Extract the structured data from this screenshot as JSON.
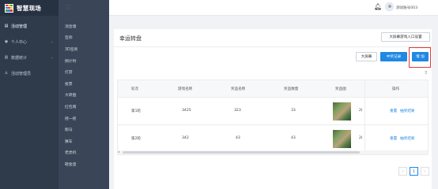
{
  "app": {
    "title": "智慧现场"
  },
  "sidebar": {
    "items": [
      {
        "label": "活动管理",
        "icon": "document-icon"
      },
      {
        "label": "个人中心",
        "icon": "user-icon"
      },
      {
        "label": "数据统计",
        "icon": "chart-icon"
      },
      {
        "label": "活动管理员",
        "icon": "admin-icon"
      }
    ]
  },
  "submenu": {
    "items": [
      "消息墙",
      "签到",
      "3D签到",
      "倒计时",
      "打赏",
      "投票",
      "大转盘",
      "红包雨",
      "摇一摇",
      "跑马",
      "赛车",
      "老虎机",
      "砸金蛋"
    ]
  },
  "header": {
    "account": "测试账号003"
  },
  "page": {
    "title": "幸运转盘",
    "buttons": {
      "big_screen_entry": "大屏幕游戏入口设置",
      "big_screen": "大屏幕",
      "win_record": "中奖记录",
      "add": "增 加"
    }
  },
  "table": {
    "columns": [
      "轮次",
      "游戏名称",
      "奖品名称",
      "奖品数量",
      "奖品图",
      "操作"
    ],
    "rows": [
      {
        "round": "第1轮",
        "game": "3425",
        "prize": "323",
        "count": "33",
        "extra": "2(",
        "actions": [
          "重置",
          "抽奖结果"
        ]
      },
      {
        "round": "第2轮",
        "game": "342",
        "prize": "43",
        "count": "43",
        "extra": "2(",
        "actions": [
          "重置",
          "抽奖结果"
        ]
      }
    ]
  },
  "pagination": {
    "prev": "‹",
    "current": "1",
    "next": "›"
  },
  "colors": {
    "primary": "#1e88e5",
    "sidebar": "#2f3a4b",
    "highlight": "#e53935"
  }
}
